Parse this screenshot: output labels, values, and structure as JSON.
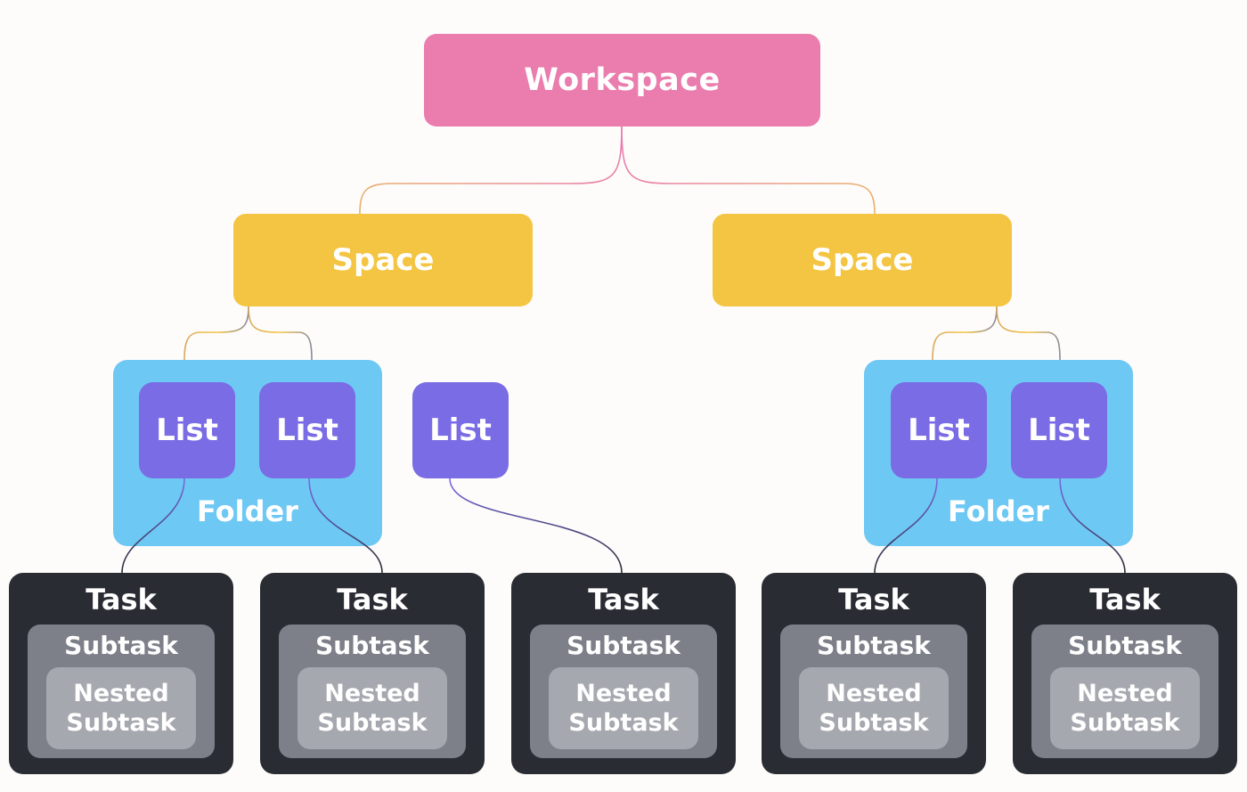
{
  "colors": {
    "background": "#fdfcfa",
    "workspace": "#EA7DAE",
    "space": "#F4C542",
    "folder": "#6EC8F4",
    "list": "#7A6CE4",
    "task": "#2A2C33",
    "subtask": "#7D8089",
    "nested_subtask": "#A6A8AF",
    "text": "#ffffff"
  },
  "workspace": {
    "label": "Workspace"
  },
  "spaces": [
    {
      "label": "Space"
    },
    {
      "label": "Space"
    }
  ],
  "folders": [
    {
      "label": "Folder",
      "lists": [
        {
          "label": "List"
        },
        {
          "label": "List"
        }
      ]
    },
    {
      "label": "Folder",
      "lists": [
        {
          "label": "List"
        },
        {
          "label": "List"
        }
      ]
    }
  ],
  "standalone_list": {
    "label": "List"
  },
  "tasks": [
    {
      "label": "Task",
      "subtask": "Subtask",
      "nested": "Nested\nSubtask"
    },
    {
      "label": "Task",
      "subtask": "Subtask",
      "nested": "Nested\nSubtask"
    },
    {
      "label": "Task",
      "subtask": "Subtask",
      "nested": "Nested\nSubtask"
    },
    {
      "label": "Task",
      "subtask": "Subtask",
      "nested": "Nested\nSubtask"
    },
    {
      "label": "Task",
      "subtask": "Subtask",
      "nested": "Nested\nSubtask"
    }
  ],
  "hierarchy": [
    {
      "from": "Workspace",
      "to": "Space (left)"
    },
    {
      "from": "Workspace",
      "to": "Space (right)"
    },
    {
      "from": "Space (left)",
      "to": "Folder (left)"
    },
    {
      "from": "Space (left)",
      "to": "List (standalone)"
    },
    {
      "from": "Space (right)",
      "to": "Folder (right)"
    },
    {
      "from": "List (folder left 1)",
      "to": "Task 1"
    },
    {
      "from": "List (folder left 2)",
      "to": "Task 2"
    },
    {
      "from": "List (standalone)",
      "to": "Task 3"
    },
    {
      "from": "List (folder right 1)",
      "to": "Task 4"
    },
    {
      "from": "List (folder right 2)",
      "to": "Task 5"
    }
  ]
}
